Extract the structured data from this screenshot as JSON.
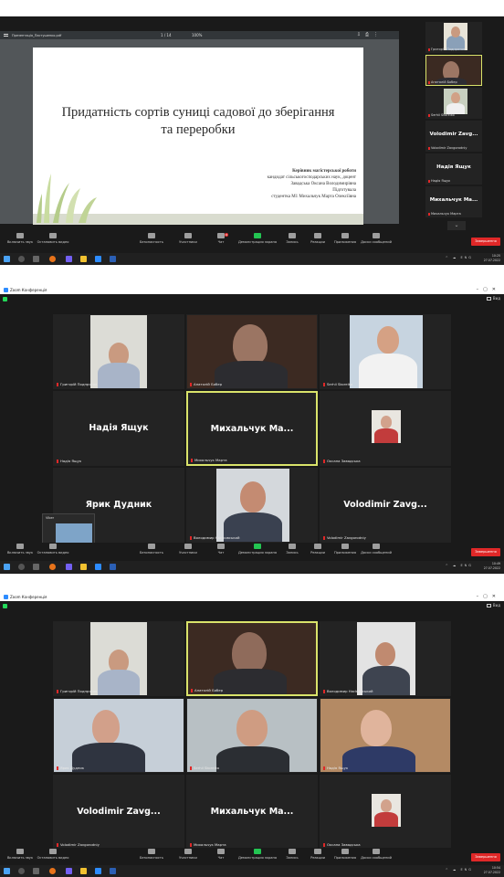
{
  "shot1": {
    "pdf": {
      "filename": "Презентація_Пастушенко.pdf",
      "page": "1 / 14",
      "zoom": "100%",
      "slide_title": "Придатність сортів суниці садової до зберігання та переробки",
      "supervisor_heading": "Керівник магістерської роботи",
      "supervisor_line1": "кандидат сільськогосподарських наук, доцент",
      "supervisor_line2": "Завадська Оксана Володимирівна",
      "prepared_label": "Підготувала",
      "student": "студентка М1 Михальчук Марта Олексіївна"
    },
    "participants": [
      {
        "name": "Григорій Подпрятов"
      },
      {
        "name": "Анатолій Бобер"
      },
      {
        "name": "Serhii Skoreiko"
      },
      {
        "big": "Volodimir Zavg...",
        "name": "Volodimir Zavgorodniy"
      },
      {
        "big": "Надія Ящук",
        "name": "Надія Ящук"
      },
      {
        "big": "Михальчук Ма...",
        "name": "Михальчук Марта"
      }
    ],
    "end_label": "Завершення",
    "clock_time": "10:25",
    "clock_date": "27.07.2022"
  },
  "shot2": {
    "window_title": "Zoom Конференція",
    "view_label": "Вид",
    "tiles": [
      {
        "name": "Григорій Подпрятов"
      },
      {
        "name": "Анатолій Бобер"
      },
      {
        "name": "Serhii Skoreiko"
      },
      {
        "big": "Надія Ящук",
        "name": "Надія Ящук"
      },
      {
        "big": "Михальчук Ма...",
        "name": "Михальчук Марта"
      },
      {
        "name": "Оксана Завадська"
      },
      {
        "big": "Ярик Дудник",
        "name": ""
      },
      {
        "name": "Володимир Насіковський"
      },
      {
        "big": "Volodimir Zavg...",
        "name": "Volodimir Zavgorodniy"
      }
    ],
    "mini_title": "Viber",
    "end_label": "Завершення",
    "clock_time": "10:49",
    "clock_date": "27.07.2022"
  },
  "shot3": {
    "window_title": "Zoom Конференція",
    "view_label": "Вид",
    "tiles": [
      {
        "name": "Григорій Подпрятов"
      },
      {
        "name": "Анатолій Бобер"
      },
      {
        "name": "Володимир Насіковський"
      },
      {
        "name": "Ярик Дудник"
      },
      {
        "name": "Serhii Skoreiko"
      },
      {
        "name": "Надія Ящук"
      },
      {
        "big": "Volodimir Zavg...",
        "name": "Volodimir Zavgorodniy"
      },
      {
        "big": "Михальчук Ма...",
        "name": "Михальчук Марта"
      },
      {
        "name": "Оксана Завадська"
      }
    ],
    "end_label": "Завершення",
    "clock_time": "10:54",
    "clock_date": "27.07.2022"
  },
  "toolbar": {
    "mute": "Включить звук",
    "video": "Остановить видео",
    "security": "Безопасность",
    "participants": "Участники",
    "participants_count": "9",
    "chat": "Чат",
    "share": "Демонстрация экрана",
    "record": "Запись",
    "reactions": "Реакции",
    "apps": "Приложения",
    "whiteboard": "Доски сообщений"
  },
  "taskbar": {
    "tray_icons": "^ ☁ ENG"
  },
  "colors": {
    "active_speaker": "#d9e36a",
    "end_button": "#e02828",
    "share_button": "#23c552"
  }
}
